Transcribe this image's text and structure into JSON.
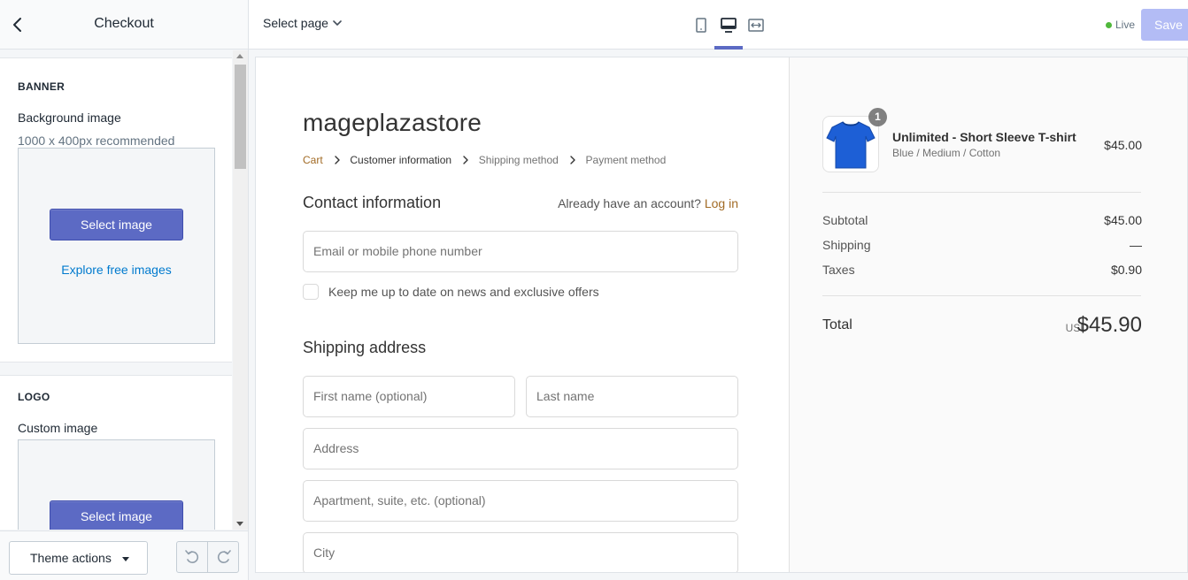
{
  "sidebar": {
    "title": "Checkout",
    "banner": {
      "heading": "BANNER",
      "label": "Background image",
      "help": "1000 x 400px recommended",
      "select_button": "Select image",
      "explore_link": "Explore free images"
    },
    "logo": {
      "heading": "LOGO",
      "label": "Custom image",
      "select_button": "Select image"
    },
    "footer": {
      "theme_actions": "Theme actions"
    }
  },
  "topbar": {
    "select_page": "Select page",
    "status": "Live",
    "save": "Save",
    "colors": {
      "accent": "#5c6ac4",
      "live": "#50b83c"
    }
  },
  "checkout": {
    "store_name": "mageplazastore",
    "breadcrumb": [
      "Cart",
      "Customer information",
      "Shipping method",
      "Payment method"
    ],
    "contact": {
      "title": "Contact information",
      "account_prompt": "Already have an account?",
      "login_link": "Log in",
      "email_placeholder": "Email or mobile phone number",
      "newsletter": "Keep me up to date on news and exclusive offers"
    },
    "shipping": {
      "title": "Shipping address",
      "first_name": "First name (optional)",
      "last_name": "Last name",
      "address": "Address",
      "apartment": "Apartment, suite, etc. (optional)",
      "city": "City"
    }
  },
  "summary": {
    "product": {
      "name": "Unlimited - Short Sleeve T-shirt",
      "variant": "Blue / Medium / Cotton",
      "price": "$45.00",
      "quantity": "1"
    },
    "subtotal_label": "Subtotal",
    "subtotal": "$45.00",
    "shipping_label": "Shipping",
    "shipping": "—",
    "taxes_label": "Taxes",
    "taxes": "$0.90",
    "total_label": "Total",
    "currency": "USD",
    "total": "$45.90"
  }
}
